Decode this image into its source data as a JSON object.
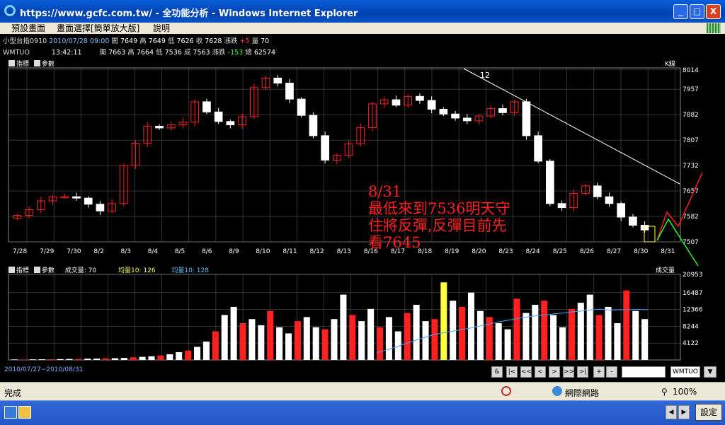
{
  "window": {
    "title": "https://www.gcfc.com.tw/ - 全功能分析 - Windows Internet Explorer",
    "min_label": "_",
    "max_label": "□",
    "close_label": "X"
  },
  "menu": {
    "items": [
      "預設畫面",
      "畫面選擇[簡單放大版]",
      "說明"
    ]
  },
  "info_rows": {
    "row1": {
      "name": "小型台指0910",
      "datetime": "2010/07/28 09:00",
      "open_label": "開",
      "open": "7649",
      "high_label": "高",
      "high": "7649",
      "low_label": "低",
      "low": "7626",
      "close_label": "收",
      "close": "7628",
      "chg_label": "漲跌",
      "chg": "+5",
      "vol_label": "量",
      "vol": "70"
    },
    "row2": {
      "name": "WMTUO",
      "time": "13:42:11",
      "open_label": "開",
      "open": "7663",
      "high_label": "高",
      "high": "7664",
      "low_label": "低",
      "low": "7536",
      "close_label": "成",
      "close": "7563",
      "chg_label": "漲跌",
      "chg": "-153",
      "vol_label": "總",
      "vol": "62574"
    }
  },
  "price_panel": {
    "ind_label": "指標",
    "param_label": "參數",
    "corner_label": "K線"
  },
  "volume_panel": {
    "ind_label": "指標",
    "param_label": "參數",
    "vol_label": "成交量: 70",
    "ma1_label": "均量10: 126",
    "ma2_label": "均量10: 128",
    "corner_label": "成交量"
  },
  "chart_data": [
    {
      "type": "candlestick",
      "x_tick_labels": [
        "7/28",
        "7/29",
        "7/30",
        "8/2",
        "8/3",
        "8/4",
        "8/5",
        "8/6",
        "8/9",
        "8/10",
        "8/11",
        "8/12",
        "8/13",
        "8/16",
        "8/17",
        "8/18",
        "8/19",
        "8/20",
        "8/23",
        "8/24",
        "8/25",
        "8/26",
        "8/27",
        "8/30",
        "8/31"
      ],
      "y_tick_labels": [
        7507,
        7582,
        7657,
        7732,
        7807,
        7882,
        7957,
        8014
      ],
      "ylim": [
        7507,
        8020
      ],
      "series": [
        {
          "values": [
            7585,
            7602,
            7628,
            7640,
            7640,
            7636,
            7618,
            7598,
            7620,
            7732,
            7798,
            7848,
            7843,
            7852,
            7860,
            7920,
            7890,
            7862,
            7852,
            7876,
            7962,
            7990,
            7975,
            7928,
            7880,
            7820,
            7748,
            7762,
            7796,
            7844,
            7914,
            7926,
            7910,
            7936,
            7924,
            7898,
            7884,
            7872,
            7864,
            7878,
            7900,
            7888,
            7920,
            7820,
            7745,
            7620,
            7608,
            7650,
            7672,
            7640,
            7620,
            7580,
            7556,
            7542
          ]
        }
      ],
      "annotations": [
        "12",
        "8/31",
        "最低來到7536明天守",
        "住將反彈,反彈目前先",
        "看7645"
      ],
      "grid": true
    },
    {
      "type": "bar",
      "y_tick_labels": [
        4122,
        8244,
        12366,
        16487,
        20953
      ],
      "ylim": [
        0,
        20953
      ],
      "series": [
        {
          "values": [
            120,
            100,
            140,
            160,
            180,
            200,
            240,
            260,
            300,
            320,
            380,
            420,
            500,
            640,
            760,
            900,
            1100,
            1400,
            1900,
            2300,
            3200,
            4500,
            7000,
            11000,
            13000,
            9000,
            10000,
            8500,
            12000,
            8000,
            6500,
            9500,
            10500,
            8000,
            7500,
            10000,
            16000,
            11000,
            9500,
            12500,
            8000,
            10500,
            7000,
            11500,
            13500,
            9500,
            10000,
            19000,
            14500,
            13000,
            16500,
            12000,
            10500,
            9000,
            7500,
            15000,
            11500,
            13500,
            14500,
            11000,
            8000,
            12500,
            14000,
            16000,
            11000,
            13000,
            9000,
            17000,
            12000,
            10000
          ]
        },
        {
          "name": "均量10",
          "values": [
            1800,
            2400,
            3100,
            3900,
            4700,
            5400,
            6100,
            6600,
            7000,
            7400,
            7800,
            8300,
            8800,
            9300,
            9700,
            10100,
            10500,
            10800,
            11000,
            11300,
            11500,
            11800,
            12000,
            12300,
            12400,
            12200,
            12300,
            12300,
            12400,
            12300
          ]
        }
      ],
      "grid": true
    }
  ],
  "bottom": {
    "date_range": "2010/07/27~2010/08/31",
    "nav_labels": [
      "&",
      "|<",
      "<<",
      "<",
      ">",
      ">>",
      ">|",
      "+",
      "-"
    ],
    "symbol": "WMTUO",
    "dropdown_arrow": "▼"
  },
  "status": {
    "done": "完成",
    "zone": "網際網路",
    "zoom": "100%"
  },
  "taskbar": {
    "settings": "設定"
  },
  "colors": {
    "up": "#ff2020",
    "down": "#ffffff",
    "grid": "#555555",
    "annotation": "#ff2020",
    "trendline": "#ffffff",
    "projection_up": "#ff2020",
    "projection_down": "#20ff20",
    "avg_line": "#4aa0ff",
    "highlight_bar": "#ffff40"
  }
}
